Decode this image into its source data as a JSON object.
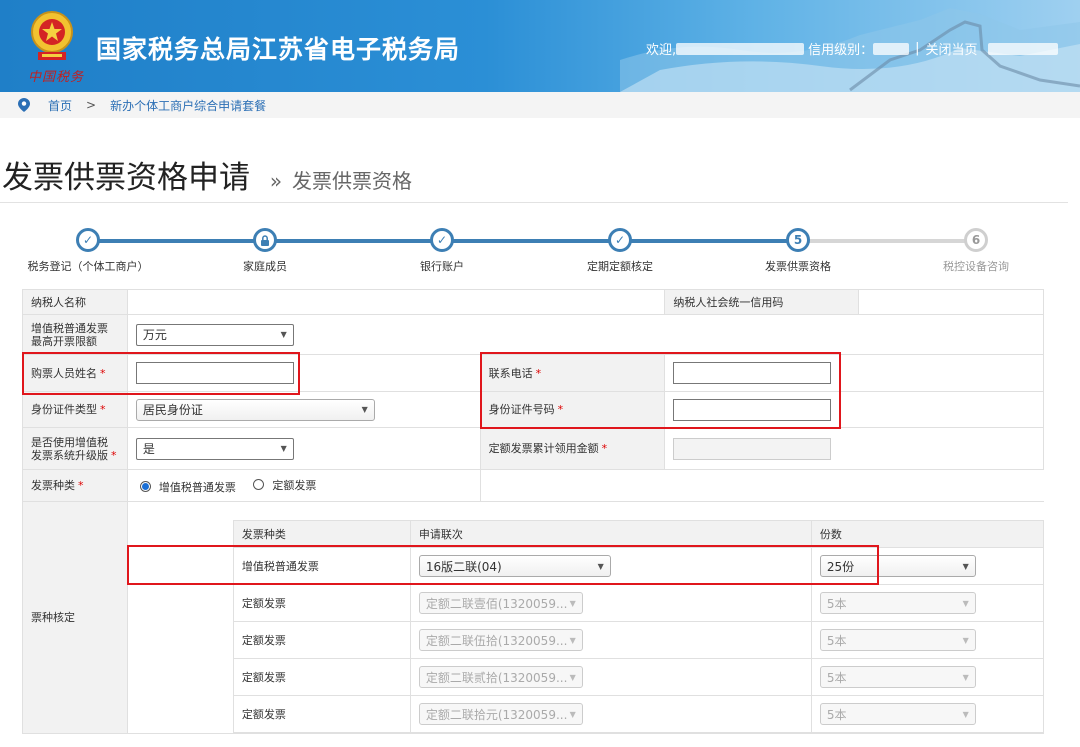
{
  "header": {
    "site_title": "国家税务总局江苏省电子税务局",
    "emblem_subtitle": "中国税务",
    "welcome": "欢迎,",
    "credit_level": "信用级别：",
    "close_page": "关闭当页"
  },
  "breadcrumb": {
    "home": "首页",
    "separator": ">",
    "current": "新办个体工商户综合申请套餐"
  },
  "page": {
    "title": "发票供票资格申请",
    "subtitle_prefix": "»",
    "subtitle": "发票供票资格"
  },
  "steps": [
    {
      "label": "税务登记（个体工商户）",
      "state": "done",
      "icon": "check-icon"
    },
    {
      "label": "家庭成员",
      "state": "done",
      "icon": "lock-icon"
    },
    {
      "label": "银行账户",
      "state": "done",
      "icon": "check-icon"
    },
    {
      "label": "定期定额核定",
      "state": "done",
      "icon": "check-icon"
    },
    {
      "label": "发票供票资格",
      "state": "current",
      "number": "5"
    },
    {
      "label": "税控设备咨询",
      "state": "todo",
      "number": "6"
    }
  ],
  "form": {
    "taxpayer_name_label": "纳税人名称",
    "credit_code_label": "纳税人社会统一信用码",
    "max_limit_label": "增值税普通发票最高开票限额",
    "max_limit_value": "万元",
    "buyer_name_label": "购票人员姓名",
    "phone_label": "联系电话",
    "id_type_label": "身份证件类型",
    "id_type_value": "居民身份证",
    "id_number_label": "身份证件号码",
    "upgrade_label": "是否使用增值税发票系统升级版",
    "upgrade_value": "是",
    "quota_total_label": "定额发票累计领用金额",
    "invoice_kind_label": "发票种类",
    "invoice_kind_options": [
      "增值税普通发票",
      "定额发票"
    ],
    "required_mark": "*",
    "ticket_section_label": "票种核定"
  },
  "ticket_table": {
    "headers": [
      "发票种类",
      "申请联次",
      "份数"
    ],
    "rows": [
      {
        "kind": "增值税普通发票",
        "copy": "16版二联(04)",
        "count": "25份",
        "disabled": false
      },
      {
        "kind": "定额发票",
        "copy": "定额二联壹佰(1320059...",
        "count": "5本",
        "disabled": true
      },
      {
        "kind": "定额发票",
        "copy": "定额二联伍拾(1320059...",
        "count": "5本",
        "disabled": true
      },
      {
        "kind": "定额发票",
        "copy": "定额二联贰拾(1320059...",
        "count": "5本",
        "disabled": true
      },
      {
        "kind": "定额发票",
        "copy": "定额二联拾元(1320059...",
        "count": "5本",
        "disabled": true
      }
    ]
  },
  "colors": {
    "accent": "#3d7fb4",
    "highlight": "#e0161c",
    "required": "#dd0000"
  }
}
